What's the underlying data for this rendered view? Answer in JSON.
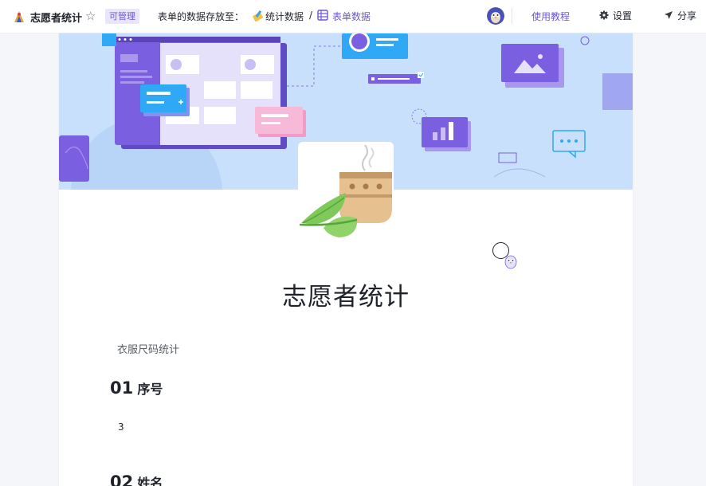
{
  "header": {
    "title": "志愿者统计",
    "permission_badge": "可管理",
    "store_label": "表单的数据存放至：",
    "folder_name": "统计数据",
    "separator": "/",
    "table_name": "表单数据",
    "tutorial_label": "使用教程",
    "settings_label": "设置",
    "share_label": "分享",
    "icons": {
      "logo": "app-logo-icon",
      "favorite": "star-icon",
      "folder": "folder-emoji-icon",
      "table": "table-grid-icon",
      "avatar": "owl-avatar",
      "settings": "gear-icon",
      "share": "send-arrow-icon"
    }
  },
  "form": {
    "heading": "志愿者统计",
    "description": "衣服尺码统计",
    "questions": [
      {
        "number": "01",
        "label": "序号",
        "answer": "3"
      },
      {
        "number": "02",
        "label": "姓名",
        "answer": ""
      }
    ]
  },
  "colors": {
    "accent": "#6b58d6",
    "banner_bg": "#c8e0fb",
    "page_bg": "#f5f6fa"
  }
}
